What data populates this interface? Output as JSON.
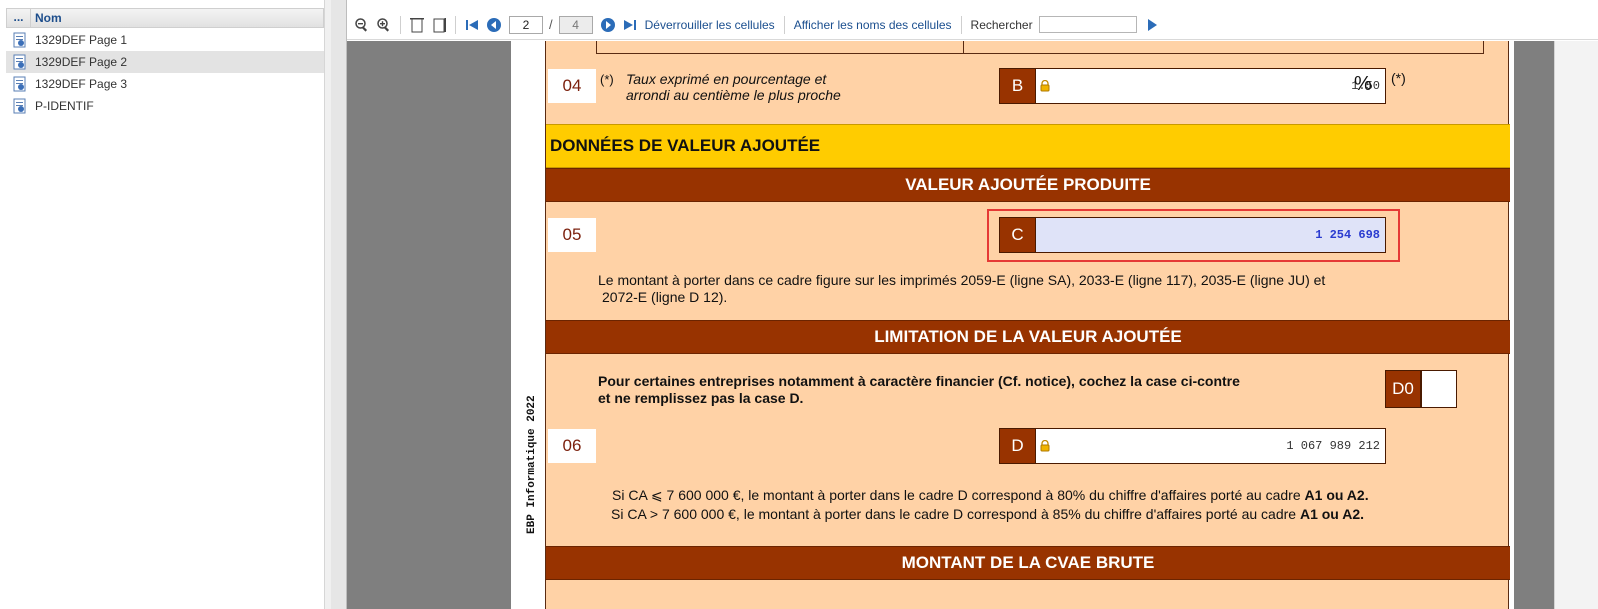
{
  "sidebar": {
    "header": {
      "dots": "...",
      "column": "Nom"
    },
    "items": [
      {
        "label": "1329DEF Page 1"
      },
      {
        "label": "1329DEF Page 2",
        "selected": true
      },
      {
        "label": "1329DEF Page 3"
      },
      {
        "label": "P-IDENTIF"
      }
    ]
  },
  "toolbar": {
    "page_current": "2",
    "page_separator": "/",
    "page_total": "4",
    "unlock_cells": "Déverrouiller les cellules",
    "show_cell_names": "Afficher les noms des cellules",
    "search_label": "Rechercher",
    "search_value": ""
  },
  "document": {
    "side_label": "EBP Informatique 2022",
    "row04": {
      "number": "04",
      "asterisk_left": "(*)",
      "note_line1": "Taux exprimé en pourcentage et",
      "note_line2": "arrondi au centième le plus proche",
      "code": "B",
      "value": "1.50",
      "unit": "%",
      "asterisk_right": "(*)"
    },
    "section_title": "DONNÉES DE VALEUR AJOUTÉE",
    "banner_value_added": "VALEUR AJOUTÉE PRODUITE",
    "row05": {
      "number": "05",
      "code": "C",
      "value": "1 254 698",
      "note_line1": "Le montant à porter dans ce cadre figure sur les imprimés 2059-E (ligne SA), 2033-E (ligne 117), 2035-E (ligne JU) et",
      "note_line2": "2072-E (ligne D 12)."
    },
    "banner_limitation": "LIMITATION DE LA VALEUR AJOUTÉE",
    "limitation_note_line1": "Pour certaines entreprises notamment à caractère financier (Cf. notice), cochez la case ci-contre",
    "limitation_note_line2": "et ne remplissez pas la case D.",
    "checkbox_code": "D0",
    "row06": {
      "number": "06",
      "code": "D",
      "value": "1 067 989 212",
      "note_line1_prefix": "Si CA  ⩽ 7 600 000 €, le montant à porter dans le cadre D correspond à 80% du chiffre d'affaires porté au cadre ",
      "note_line1_bold": "A1 ou A2.",
      "note_line2_prefix": "Si CA > 7 600 000 €, le montant à porter dans le cadre D correspond à 85% du chiffre d'affaires porté au cadre ",
      "note_line2_bold": "A1 ou A2."
    },
    "banner_cvae": "MONTANT DE LA CVAE BRUTE"
  },
  "colors": {
    "banner": "#983300",
    "form_background": "#ffd2a6",
    "section_yellow": "#ffcc00",
    "label_text": "#7b1f0c",
    "active_value": "#2a3bd0",
    "highlight_border": "#e53935",
    "toolbar_link": "#1b4f8f"
  },
  "icons": {
    "toolbar": [
      "zoom-out-icon",
      "zoom-in-icon",
      "fit-page-icon",
      "fit-width-icon",
      "first-page-icon",
      "previous-page-icon",
      "next-page-icon",
      "last-page-icon",
      "search-go-icon"
    ],
    "tree_item": "form-page-icon",
    "field_lock": "lock-icon"
  }
}
